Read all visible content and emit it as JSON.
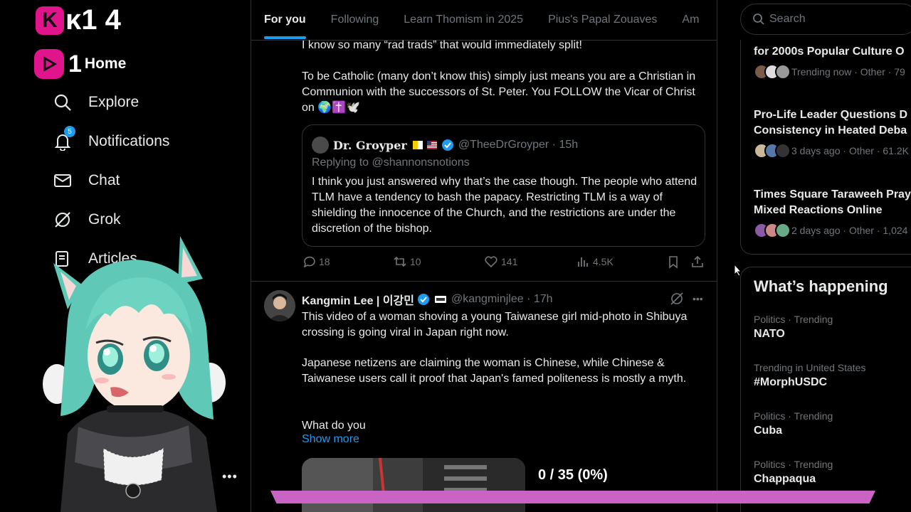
{
  "brand": {
    "prefix_badge": "K",
    "text": "κ1 4"
  },
  "nav": {
    "home": {
      "counter": "1",
      "label": "Home"
    },
    "items": [
      {
        "label": "Explore",
        "icon": "search-icon"
      },
      {
        "label": "Notifications",
        "icon": "bell-icon",
        "badge": "5"
      },
      {
        "label": "Chat",
        "icon": "envelope-icon"
      },
      {
        "label": "Grok",
        "icon": "grok-icon"
      },
      {
        "label": "Articles",
        "icon": "articles-icon"
      }
    ],
    "more": "•••"
  },
  "tabs": [
    {
      "label": "For you",
      "active": true
    },
    {
      "label": "Following",
      "active": false
    },
    {
      "label": "Learn Thomism in 2025",
      "active": false
    },
    {
      "label": "Pius's Papal Zouaves",
      "active": false
    },
    {
      "label": "Am",
      "active": false
    }
  ],
  "post1": {
    "line1": "I know so many “rad trads” that would immediately split!",
    "para2": "To be Catholic (many don’t know this) simply just means you are a Christian in Communion with the successors of St. Peter. You FOLLOW the Vicar of Christ on",
    "emoji_tail": "🌍✝️🕊️",
    "quote": {
      "name": "Dr. Groyper",
      "handle": "@TheeDrGroyper",
      "time": "15h",
      "replying": "Replying to @shannonsnotions",
      "body": "I think you just answered why that’s the case though. The people who attend TLM have a tendency to bash the papacy. Restricting TLM is a way of shielding the innocence of the Church, and the restrictions are under the discretion of the bishop."
    },
    "actions": {
      "replies": "18",
      "reposts": "10",
      "likes": "141",
      "views": "4.5K"
    }
  },
  "post2": {
    "name": "Kangmin Lee | 이강민",
    "handle": "@kangminjlee",
    "time": "17h",
    "para1": "This video of a woman shoving a young Taiwanese girl mid-photo in Shibuya crossing is going viral in Japan right now.",
    "para2": "Japanese netizens are claiming the woman is Chinese, while Chinese & Taiwanese users call it proof that Japan's famed politeness is mostly a myth.",
    "para3": "What do you",
    "show_more": "Show more",
    "more_icon": "•••"
  },
  "search": {
    "placeholder": "Search"
  },
  "news": [
    {
      "title": "for 2000s Popular Culture O",
      "meta": "Trending now · Other · 79"
    },
    {
      "title": "Pro-Life Leader Questions D",
      "title2": "Consistency in Heated Deba",
      "meta": "3 days ago · Other · 61.2K"
    },
    {
      "title": "Times Square Taraweeh Pray",
      "title2": "Mixed Reactions Online",
      "meta": "2 days ago · Other · 1,024"
    }
  ],
  "whats_happening": {
    "heading": "What’s happening",
    "trends": [
      {
        "context": "Politics · Trending",
        "topic": "NATO"
      },
      {
        "context": "Trending in United States",
        "topic": "#MorphUSDC"
      },
      {
        "context": "Politics · Trending",
        "topic": "Cuba"
      },
      {
        "context": "Politics · Trending",
        "topic": "Chappaqua"
      }
    ]
  },
  "overlay": {
    "progress_text": "0 / 35 (0%)",
    "progress_fraction": 0.0,
    "bar_color": "#c964c4"
  },
  "colors": {
    "accent": "#1d9bf0",
    "brand": "#e0158c",
    "background": "#000000",
    "border": "#2f3336",
    "muted": "#71767b"
  }
}
